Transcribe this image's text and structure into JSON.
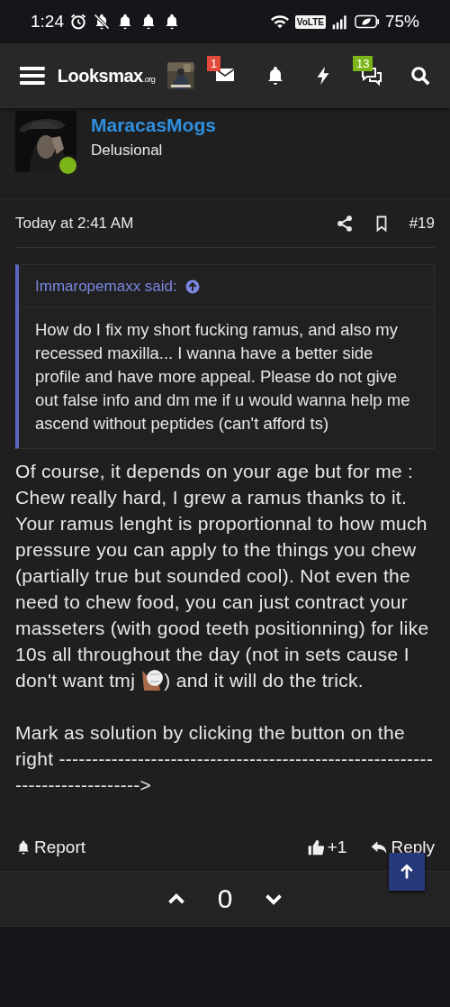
{
  "status_bar": {
    "time": "1:24",
    "network_badge": "VoLTE",
    "battery": "75%"
  },
  "header": {
    "logo": "Looksmax",
    "logo_suffix": ".org",
    "inbox_badge": "1",
    "conversations_badge": "13"
  },
  "post": {
    "author": "MaracasMogs",
    "user_title": "Delusional",
    "online": true,
    "date": "Today at 2:41 AM",
    "post_number": "#19",
    "quote": {
      "author": "Immaropemaxx said:",
      "text": "How do I fix my short fucking ramus, and also my recessed maxilla... I wanna have a better side profile and have more appeal. Please do not give out false info and dm me if u would wanna help me ascend without peptides (can't afford ts)"
    },
    "paragraphs": [
      {
        "segments": [
          {
            "kind": "text",
            "text": "Of course, it depends on your age but for me : Chew really hard, I grew a ramus thanks to it. Your ramus lenght is proportionnal to how much pressure you can apply to the things you chew (partially true but sounded cool). Not even the need to chew food, you can just contract your masseters (with good teeth positionning) for like 10s all throughout the day (not in sets cause I don't want tmj "
          },
          {
            "kind": "emoji"
          },
          {
            "kind": "text",
            "text": ") and it will do the trick."
          }
        ]
      },
      {
        "segments": [
          {
            "kind": "text",
            "text": "Mark as solution by clicking the button on the right ---------------------------------------------------------------------------->"
          }
        ]
      }
    ],
    "actions": {
      "report": "Report",
      "likes": "+1",
      "reply": "Reply"
    },
    "votes": {
      "score": "0"
    }
  }
}
